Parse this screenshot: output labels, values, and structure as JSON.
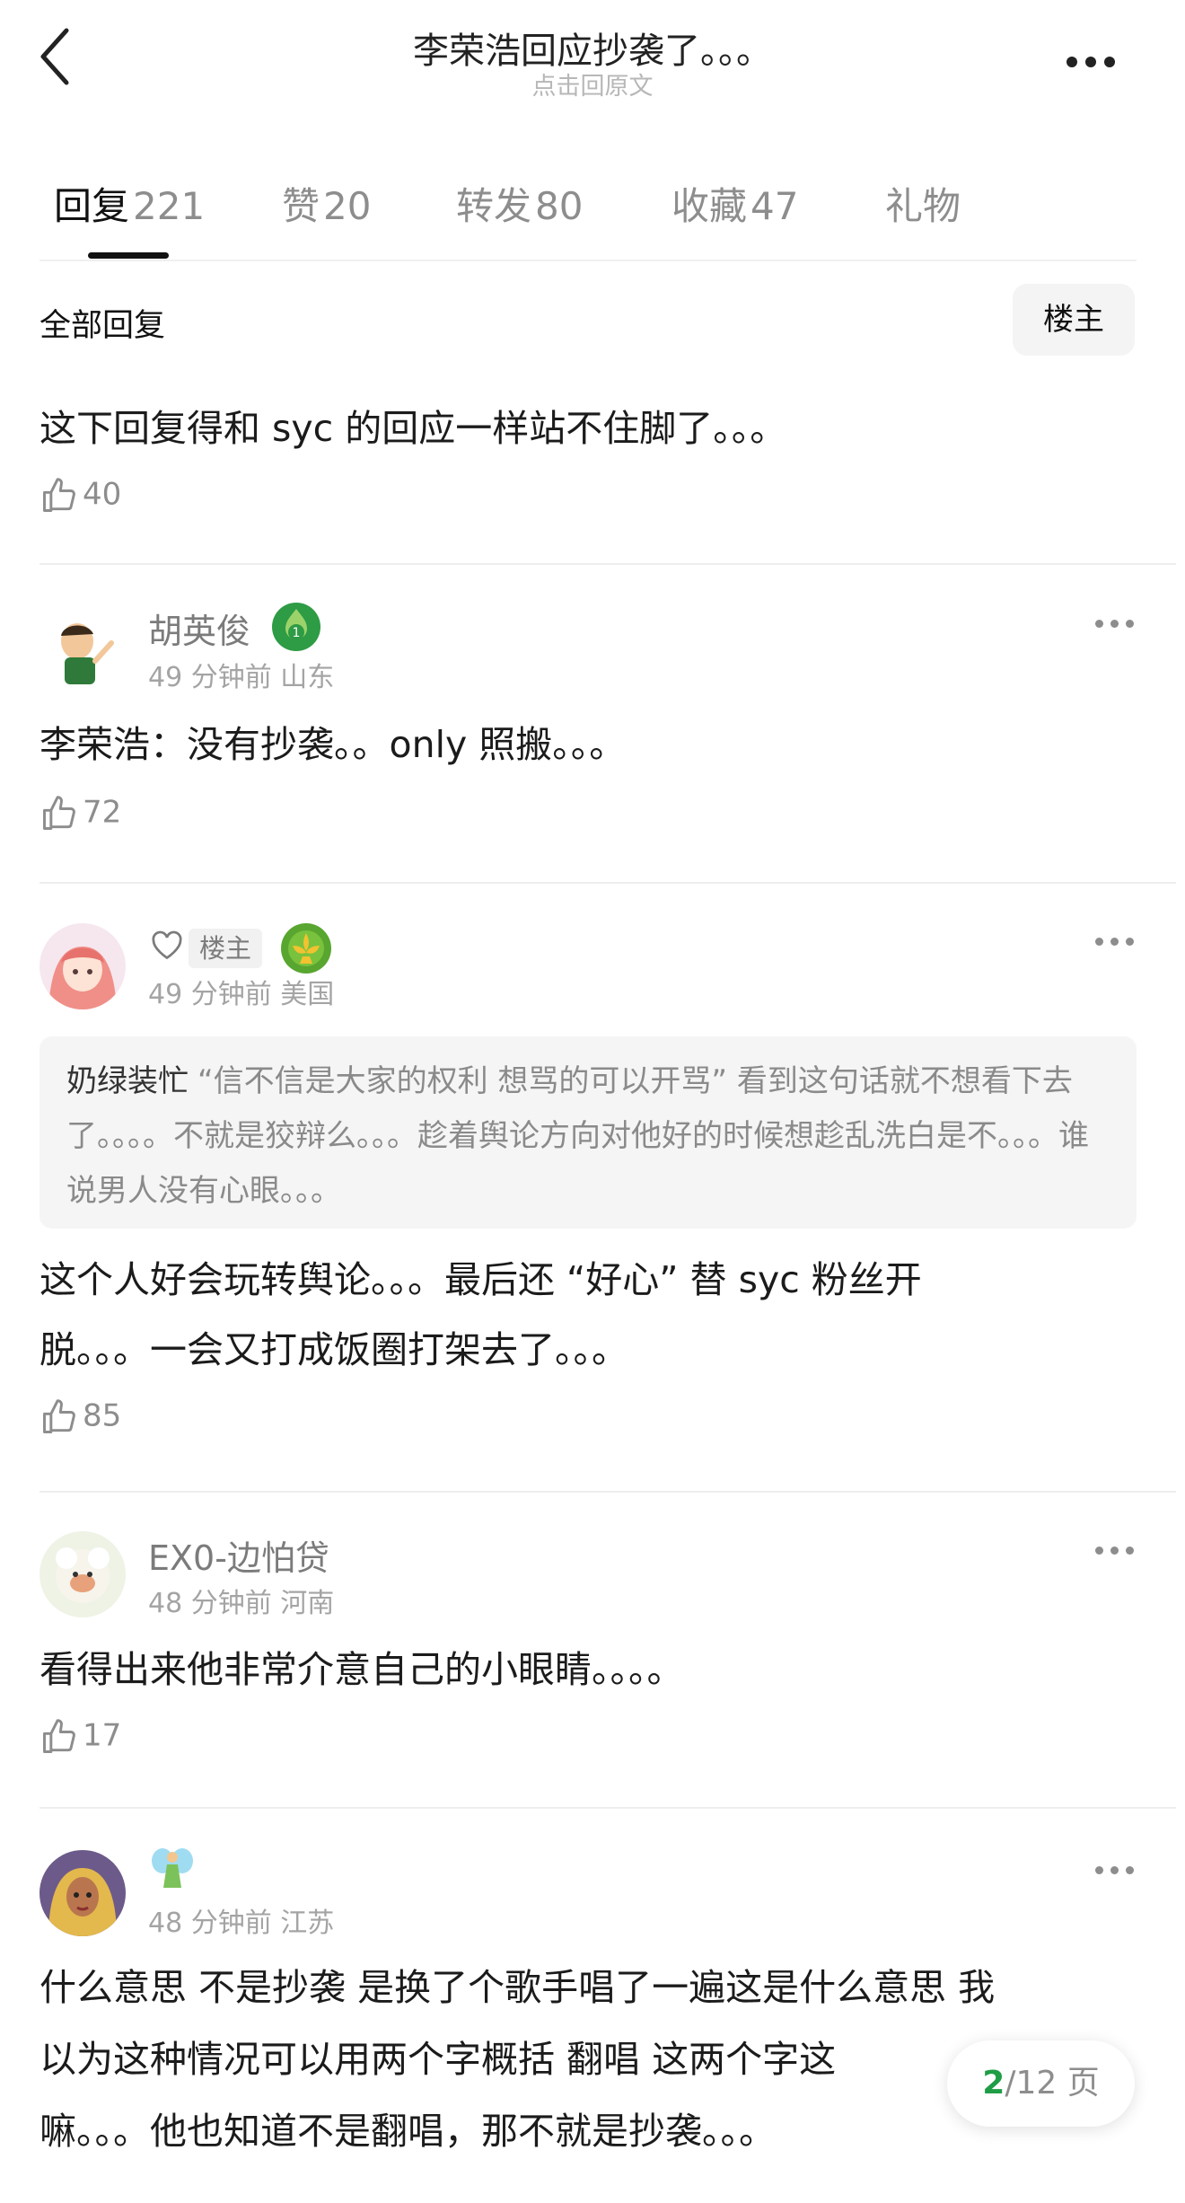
{
  "header": {
    "title": "李荣浩回应抄袭了。。。",
    "subtitle": "点击回原文"
  },
  "tabs": [
    {
      "label": "回复",
      "count": "221",
      "active": true
    },
    {
      "label": "赞",
      "count": "20"
    },
    {
      "label": "转发",
      "count": "80"
    },
    {
      "label": "收藏",
      "count": "47"
    },
    {
      "label": "礼物",
      "count": ""
    }
  ],
  "replies_header": {
    "title": "全部回复",
    "op_filter": "楼主"
  },
  "first_reply": {
    "text": "这下回复得和 syc 的回应一样站不住脚了。。。",
    "likes": "40"
  },
  "comments": [
    {
      "user": "胡英俊",
      "time": "49 分钟前",
      "location": "山东",
      "badge_level": "1",
      "text": "李荣浩：没有抄袭。。only 照搬。。。",
      "likes": "72"
    },
    {
      "user": "",
      "op_tag": "楼主",
      "time": "49 分钟前",
      "location": "美国",
      "quote_user": "奶绿装忙",
      "quote_text": "“信不信是大家的权利 想骂的可以开骂” 看到这句话就不想看下去了。。。。不就是狡辩么。。。趁着舆论方向对他好的时候想趁乱洗白是不。。。谁说男人没有心眼。。。",
      "text_line1": "这个人好会玩转舆论。。。最后还 “好心” 替 syc 粉丝开",
      "text_line2": "脱。。。一会又打成饭圈打架去了。。。",
      "likes": "85"
    },
    {
      "user": "EX0-边怕贷",
      "time": "48 分钟前",
      "location": "河南",
      "text": "看得出来他非常介意自己的小眼睛。。。。",
      "likes": "17"
    },
    {
      "user": "",
      "time": "48 分钟前",
      "location": "江苏",
      "text_line1": "什么意思 不是抄袭 是换了个歌手唱了一遍这是什么意思 我",
      "text_line2": "以为这种情况可以用两个字概括 翻唱 这两个字这",
      "text_line3": "嘛。。。他也知道不是翻唱，那不就是抄袭。。。"
    }
  ],
  "pager": {
    "current": "2",
    "total_text": "/12 页"
  },
  "colors": {
    "accent_green": "#1f9d46",
    "muted": "#8d8d8d"
  }
}
